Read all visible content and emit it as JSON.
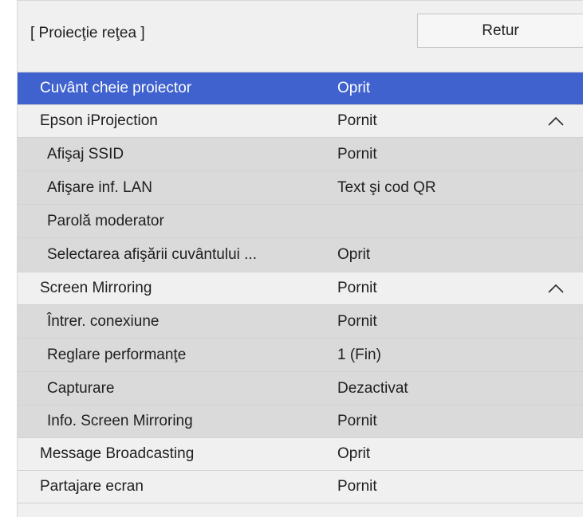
{
  "header": {
    "title": "[ Proiecţie reţea ]",
    "return_label": "Retur"
  },
  "rows": [
    {
      "label": "Cuvânt cheie proiector",
      "value": "Oprit"
    },
    {
      "label": "Epson iProjection",
      "value": "Pornit",
      "icon": "chevron-up-icon"
    },
    {
      "label": "Afişaj SSID",
      "value": "Pornit"
    },
    {
      "label": "Afişare inf. LAN",
      "value": "Text şi cod QR"
    },
    {
      "label": "Parolă moderator",
      "value": ""
    },
    {
      "label": "Selectarea afişării cuvântului ...",
      "value": "Oprit"
    },
    {
      "label": "Screen Mirroring",
      "value": "Pornit",
      "icon": "chevron-up-icon"
    },
    {
      "label": "Întrer. conexiune",
      "value": "Pornit"
    },
    {
      "label": "Reglare performanţe",
      "value": "1 (Fin)"
    },
    {
      "label": "Capturare",
      "value": "Dezactivat"
    },
    {
      "label": "Info. Screen Mirroring",
      "value": "Pornit"
    },
    {
      "label": "Message Broadcasting",
      "value": "Oprit"
    },
    {
      "label": "Partajare ecran",
      "value": "Pornit"
    }
  ],
  "colors": {
    "selection": "#3f62cf",
    "panel": "#f0f0f0",
    "sub_row": "#dadada",
    "text": "#1f1f1f"
  }
}
